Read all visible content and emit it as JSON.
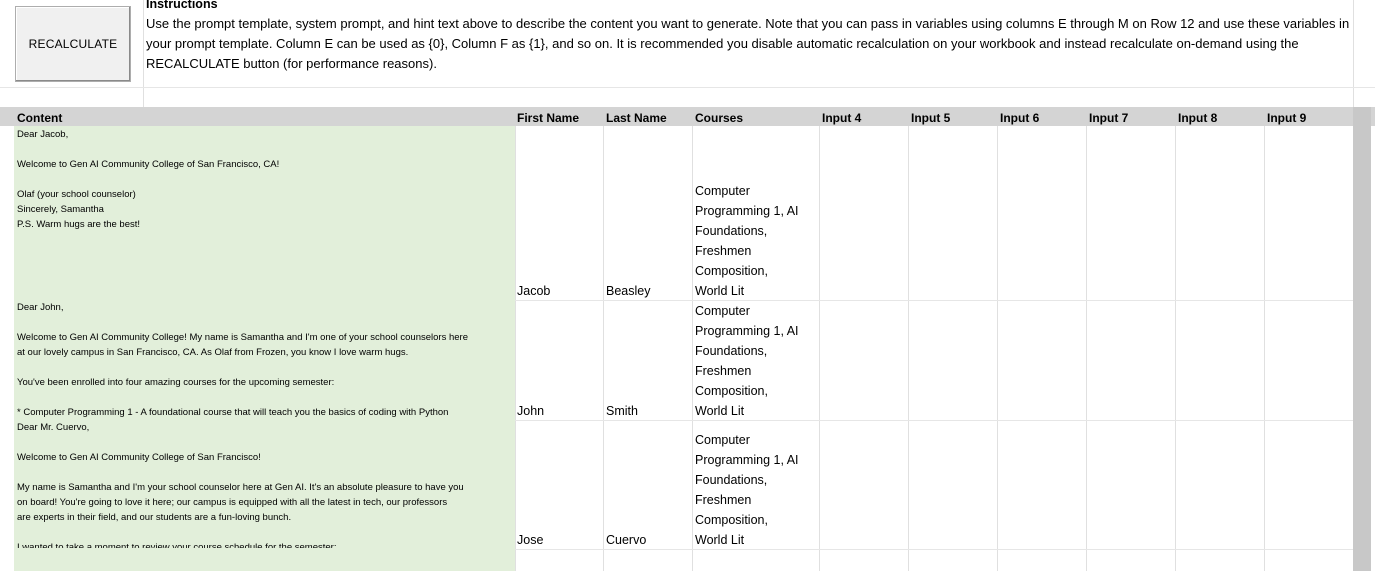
{
  "button": {
    "label": "RECALCULATE"
  },
  "instructions": {
    "title": "Instructions",
    "text": "Use the prompt template, system prompt, and hint text above to describe the content you want to generate. Note that you can pass in variables using columns E through M on Row 12 and use these variables in your prompt template. Column E can be used as {0}, Column F as {1}, and so on. It is recommended you disable automatic recalculation on your workbook and instead recalculate on-demand using the RECALCULATE button (for performance reasons)."
  },
  "headers": [
    "Content",
    "First Name",
    "Last Name",
    "Courses",
    "Input 4",
    "Input 5",
    "Input 6",
    "Input 7",
    "Input 8",
    "Input 9"
  ],
  "rows": [
    {
      "content_lines": [
        "Dear Jacob,",
        "",
        "Welcome to Gen AI Community College of San Francisco, CA!",
        "",
        "Olaf (your school counselor)",
        "Sincerely, Samantha",
        "P.S. Warm hugs are the best!"
      ],
      "first_name": "Jacob",
      "last_name": "Beasley",
      "courses_lines": [
        "Computer",
        "Programming 1, AI",
        "Foundations,",
        "Freshmen",
        "Composition,",
        "World Lit"
      ]
    },
    {
      "content_lines": [
        "Dear John,",
        "",
        "Welcome to Gen AI Community College! My name is Samantha and I'm one of your school counselors here",
        "at our lovely campus in San Francisco, CA. As Olaf from Frozen, you know I love warm hugs.",
        "",
        "You've been enrolled into four amazing courses for the upcoming semester:",
        "",
        "* Computer Programming 1 - A foundational course that will teach you the basics of coding with Python"
      ],
      "first_name": "John",
      "last_name": "Smith",
      "courses_lines": [
        "Computer",
        "Programming 1, AI",
        "Foundations,",
        "Freshmen",
        "Composition,",
        "World Lit"
      ]
    },
    {
      "content_lines": [
        "Dear Mr. Cuervo,",
        "",
        "Welcome to Gen AI Community College of San Francisco!",
        "",
        "My name is Samantha and I'm your school counselor here at Gen AI. It's an absolute pleasure to have you",
        "on board! You're going to love it here; our campus is equipped with all the latest in tech, our professors",
        "are experts in their field, and our students are a fun-loving bunch.",
        "",
        "I wanted to take a moment to review your course schedule for the semester:"
      ],
      "first_name": "Jose",
      "last_name": "Cuervo",
      "courses_lines": [
        "Computer",
        "Programming 1, AI",
        "Foundations,",
        "Freshmen",
        "Composition,",
        "World Lit"
      ]
    }
  ]
}
